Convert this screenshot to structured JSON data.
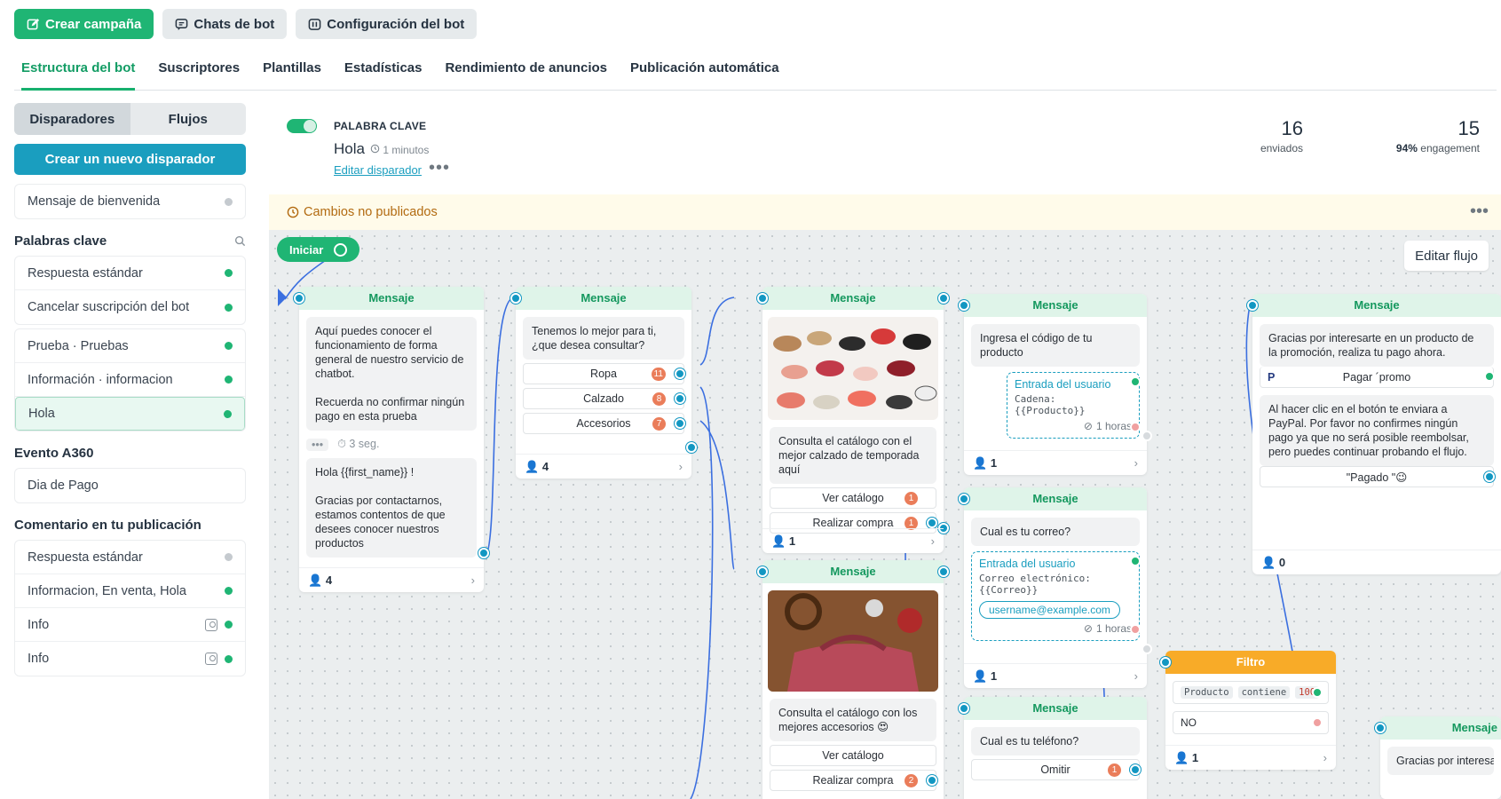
{
  "toolbar": {
    "create_campaign": "Crear campaña",
    "bot_chats": "Chats de bot",
    "bot_config": "Configuración del bot"
  },
  "tabs": [
    "Estructura del bot",
    "Suscriptores",
    "Plantillas",
    "Estadísticas",
    "Rendimiento de anuncios",
    "Publicación automática"
  ],
  "sidebar": {
    "seg_triggers": "Disparadores",
    "seg_flows": "Flujos",
    "create_trigger": "Crear un nuevo disparador",
    "welcome": "Mensaje de bienvenida",
    "keywords_title": "Palabras clave",
    "keywords_a": [
      "Respuesta estándar",
      "Cancelar suscripción del bot"
    ],
    "keywords_b": [
      "Prueba · Pruebas",
      "Información · informacion",
      "Hola"
    ],
    "event_title": "Evento A360",
    "event_item": "Dia de Pago",
    "comment_title": "Comentario en tu publicación",
    "comments": [
      "Respuesta estándar",
      "Informacion, En venta, Hola",
      "Info",
      "Info"
    ]
  },
  "header": {
    "type": "PALABRA CLAVE",
    "name": "Hola",
    "time": "1 minutos",
    "edit": "Editar disparador",
    "sent_value": "16",
    "sent_label": "enviados",
    "eng_value": "15",
    "eng_pct": "94%",
    "eng_label": "engagement",
    "banner": "Cambios no publicados"
  },
  "canvas": {
    "start": "Iniciar",
    "edit_flow": "Editar flujo",
    "node_title": "Mensaje",
    "filter_title": "Filtro",
    "n1": {
      "text1": "Aquí puedes conocer el funcionamiento de forma general de nuestro servicio de chatbot.\n\nRecuerda no confirmar ningún pago en esta prueba",
      "delay": "3 seg.",
      "text2": "Hola  {{first_name}} !\n\nGracias por contactarnos, estamos contentos de que desees conocer nuestros productos",
      "count": "4"
    },
    "n2": {
      "text": "Tenemos lo mejor para ti, ¿que desea consultar?",
      "opts": [
        {
          "label": "Ropa",
          "badge": "11"
        },
        {
          "label": "Calzado",
          "badge": "8"
        },
        {
          "label": "Accesorios",
          "badge": "7"
        }
      ],
      "count": "4"
    },
    "n3": {
      "text": "Consulta el catálogo con el mejor calzado de temporada aquí",
      "btn1": "Ver catálogo",
      "b1": "1",
      "btn2": "Realizar compra",
      "b2": "1",
      "count": "1"
    },
    "n4": {
      "text": "Consulta el catálogo con los mejores accesorios 😍",
      "btn1": "Ver catálogo",
      "btn2": "Realizar compra",
      "b2": "2"
    },
    "n5": {
      "text": "Ingresa el código de tu producto",
      "input_title": "Entrada del usuario",
      "input_sub": "Cadena: {{Producto}}",
      "timeout": "1 horas",
      "count": "1"
    },
    "n6": {
      "text": "Cual es tu correo?",
      "input_title": "Entrada del usuario",
      "input_sub": "Correo electrónico: {{Correo}}",
      "email": "username@example.com",
      "timeout": "1 horas",
      "count": "1"
    },
    "n7": {
      "text": "Cual es tu teléfono?",
      "opt": "Omitir",
      "badge": "1"
    },
    "filter": {
      "chip1": "Producto",
      "chip2": "contiene",
      "chip3": "100",
      "no": "NO",
      "count": "1"
    },
    "n8": {
      "text": "Gracias por interesarte en un producto de la promoción, realiza tu pago ahora.",
      "pay": "Pagar ´promo",
      "text2": "Al hacer clic en el botón te enviara a PayPal. Por favor no confirmes ningún pago ya que no será posible reembolsar, pero puedes continuar probando el flujo.",
      "paid": "\"Pagado \"😉",
      "count": "0"
    },
    "n9": {
      "text": "Gracias por interesar"
    }
  },
  "colors": {
    "accent": "#1fb574",
    "blue": "#1a9ebf",
    "warning": "#b26a10",
    "filter": "#f8ab28"
  }
}
